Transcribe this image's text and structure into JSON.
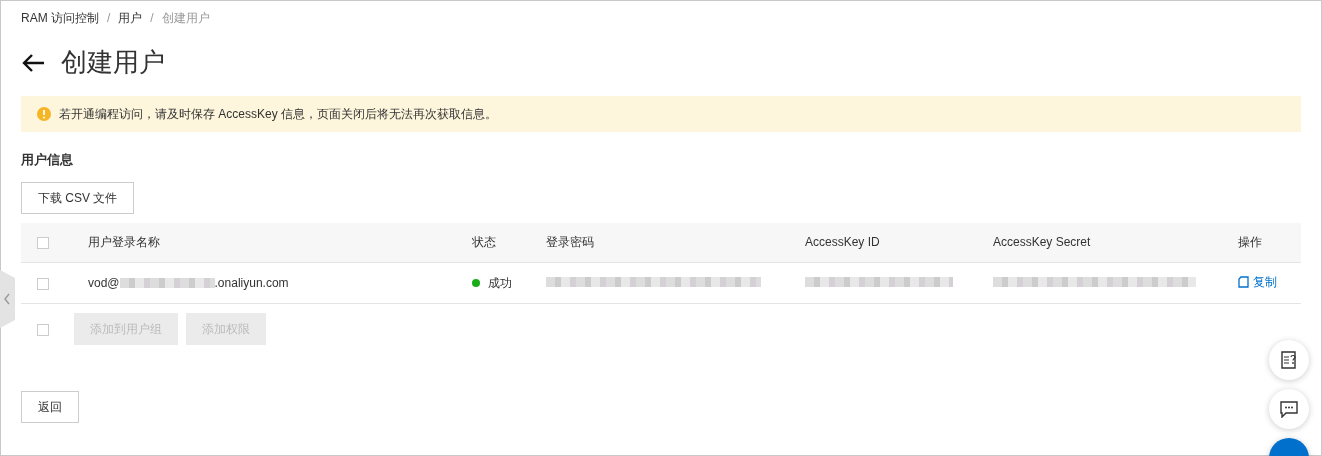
{
  "breadcrumb": [
    {
      "label": "RAM 访问控制",
      "current": false
    },
    {
      "label": "用户",
      "current": false
    },
    {
      "label": "创建用户",
      "current": true
    }
  ],
  "breadcrumb_separator": "/",
  "page_title": "创建用户",
  "alert": {
    "text": "若开通编程访问，请及时保存 AccessKey 信息，页面关闭后将无法再次获取信息。"
  },
  "section_title": "用户信息",
  "download_button": "下载 CSV 文件",
  "table": {
    "select_all_checked": false,
    "columns": [
      "用户登录名称",
      "状态",
      "登录密码",
      "AccessKey ID",
      "AccessKey Secret",
      "操作"
    ],
    "rows": [
      {
        "checked": false,
        "email_prefix": "vod@",
        "email_suffix": ".onaliyun.com",
        "status": "成功",
        "color": "#1aad19",
        "action": "复制"
      }
    ]
  },
  "bulk_actions": {
    "checked": false,
    "buttons": [
      {
        "label": "添加到用户组",
        "disabled": true
      },
      {
        "label": "添加权限",
        "disabled": true
      }
    ]
  },
  "back_button": "返回"
}
